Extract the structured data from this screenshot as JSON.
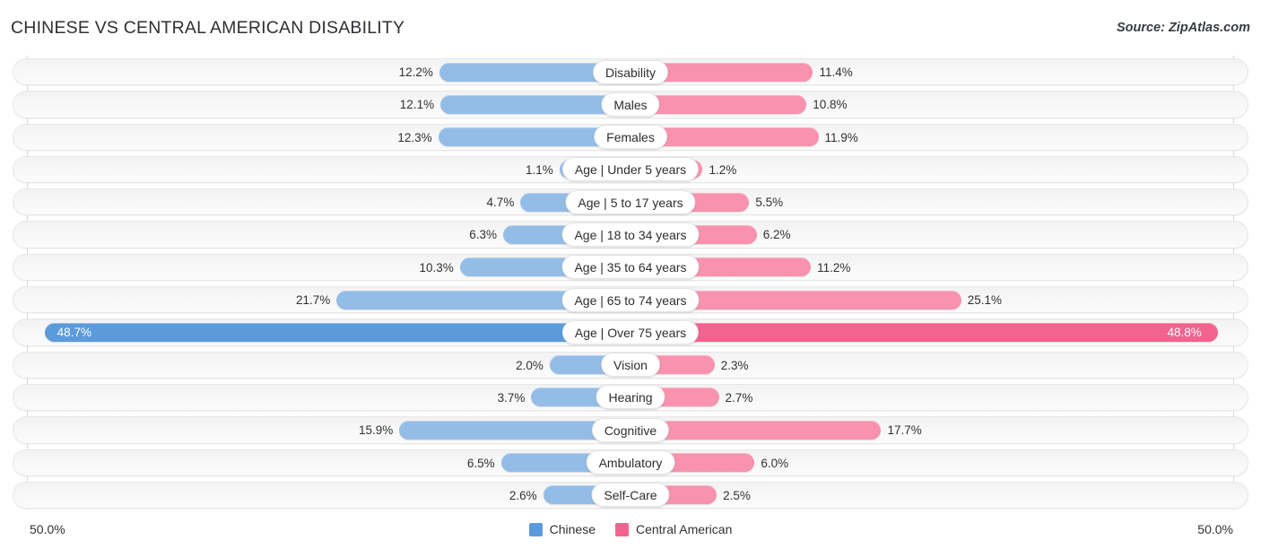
{
  "header": {
    "title": "CHINESE VS CENTRAL AMERICAN DISABILITY",
    "source": "Source: ZipAtlas.com"
  },
  "axis": {
    "left_label": "50.0%",
    "right_label": "50.0%",
    "max": 50.0
  },
  "legend": {
    "items": [
      {
        "label": "Chinese",
        "color": "#5b9bdb"
      },
      {
        "label": "Central American",
        "color": "#f4628f"
      }
    ]
  },
  "colors": {
    "left_bar": "#93bde7",
    "right_bar": "#f892ae",
    "left_bar_highlight": "#5b9bdb",
    "right_bar_highlight": "#f4628f",
    "track": "#f5f5f5",
    "gridline": "#d8dade"
  },
  "chart_data": {
    "type": "bar",
    "orientation": "diverging-horizontal",
    "title": "CHINESE VS CENTRAL AMERICAN DISABILITY",
    "xlabel": "",
    "ylabel": "",
    "xlim": [
      50.0,
      50.0
    ],
    "grid": false,
    "legend_position": "bottom-center",
    "categories": [
      "Disability",
      "Males",
      "Females",
      "Age | Under 5 years",
      "Age | 5 to 17 years",
      "Age | 18 to 34 years",
      "Age | 35 to 64 years",
      "Age | 65 to 74 years",
      "Age | Over 75 years",
      "Vision",
      "Hearing",
      "Cognitive",
      "Ambulatory",
      "Self-Care"
    ],
    "series": [
      {
        "name": "Chinese",
        "side": "left",
        "color": "#93bde7",
        "values": [
          12.2,
          12.1,
          12.3,
          1.1,
          4.7,
          6.3,
          10.3,
          21.7,
          48.7,
          2.0,
          3.7,
          15.9,
          6.5,
          2.6
        ],
        "labels": [
          "12.2%",
          "12.1%",
          "12.3%",
          "1.1%",
          "4.7%",
          "6.3%",
          "10.3%",
          "21.7%",
          "48.7%",
          "2.0%",
          "3.7%",
          "15.9%",
          "6.5%",
          "2.6%"
        ]
      },
      {
        "name": "Central American",
        "side": "right",
        "color": "#f892ae",
        "values": [
          11.4,
          10.8,
          11.9,
          1.2,
          5.5,
          6.2,
          11.2,
          25.1,
          48.8,
          2.3,
          2.7,
          17.7,
          6.0,
          2.5
        ],
        "labels": [
          "11.4%",
          "10.8%",
          "11.9%",
          "1.2%",
          "5.5%",
          "6.2%",
          "11.2%",
          "25.1%",
          "48.8%",
          "2.3%",
          "2.7%",
          "17.7%",
          "6.0%",
          "2.5%"
        ]
      }
    ],
    "highlight_rows": [
      8
    ]
  }
}
